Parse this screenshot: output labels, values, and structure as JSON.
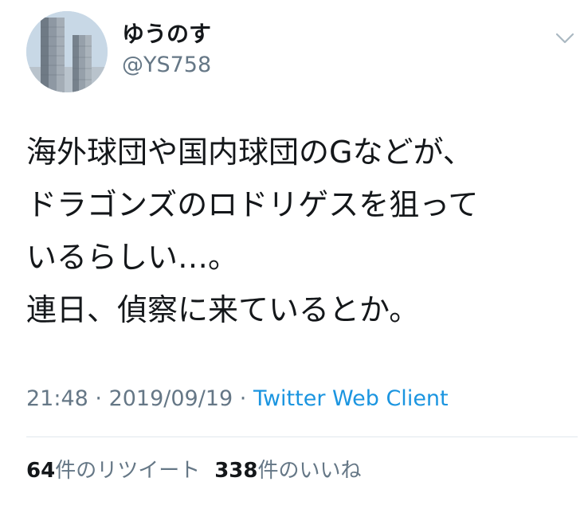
{
  "user": {
    "display_name": "ゆうのす",
    "handle": "@YS758"
  },
  "menu_icon": "chevron-down-icon",
  "tweet": {
    "text": "海外球団や国内球団のGなどが、\nドラゴンズのロドリゲスを狙って\nいるらしい…。\n連日、偵察に来ているとか。"
  },
  "meta": {
    "time": "21:48",
    "separator": " · ",
    "date": "2019/09/19",
    "client": "Twitter Web Client"
  },
  "stats": {
    "retweets_count": "64",
    "retweets_label": "件のリツイート",
    "likes_count": "338",
    "likes_label": "件のいいね"
  },
  "colors": {
    "text": "#14171a",
    "secondary": "#657786",
    "link": "#1b95e0",
    "divider": "#e1e8ed"
  }
}
